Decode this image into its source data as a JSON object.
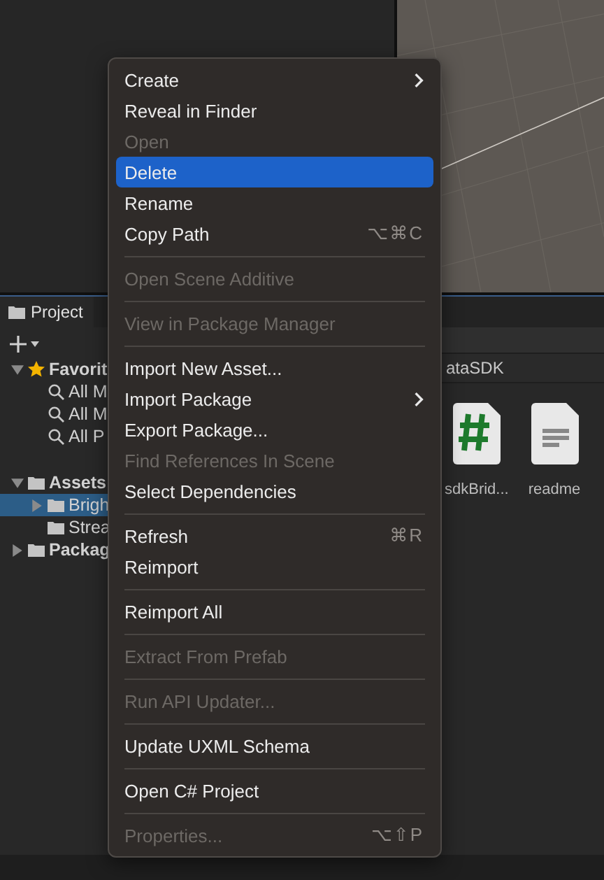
{
  "project_tab": {
    "label": "Project",
    "selected": true
  },
  "tree": [
    {
      "label": "Favorit",
      "kind": "star",
      "expanded": true,
      "selected": false,
      "children": [
        {
          "label": "All M",
          "kind": "search",
          "selected": false
        },
        {
          "label": "All M",
          "kind": "search",
          "selected": false
        },
        {
          "label": "All P",
          "kind": "search",
          "selected": false
        }
      ]
    },
    {
      "label": "Assets",
      "kind": "folder",
      "expanded": true,
      "selected": false,
      "children": [
        {
          "label": "Brigh",
          "kind": "folder",
          "expanded": false,
          "selected": true
        },
        {
          "label": "Strea",
          "kind": "folder",
          "selected": false
        }
      ]
    },
    {
      "label": "Packag",
      "kind": "folder",
      "expanded": false,
      "selected": false
    }
  ],
  "breadcrumb": "ataSDK",
  "files": [
    {
      "label": "sdkBrid...",
      "kind": "script"
    },
    {
      "label": "readme",
      "kind": "text"
    }
  ],
  "menu": [
    {
      "kind": "item",
      "label": "Create",
      "submenu": true,
      "disabled": false,
      "selected": false
    },
    {
      "kind": "item",
      "label": "Reveal in Finder",
      "disabled": false,
      "selected": false
    },
    {
      "kind": "item",
      "label": "Open",
      "disabled": true,
      "selected": false
    },
    {
      "kind": "item",
      "label": "Delete",
      "disabled": false,
      "selected": true
    },
    {
      "kind": "item",
      "label": "Rename",
      "disabled": false,
      "selected": false
    },
    {
      "kind": "item",
      "label": "Copy Path",
      "shortcut": "⌥⌘C",
      "disabled": false,
      "selected": false
    },
    {
      "kind": "separator"
    },
    {
      "kind": "item",
      "label": "Open Scene Additive",
      "disabled": true,
      "selected": false
    },
    {
      "kind": "separator"
    },
    {
      "kind": "item",
      "label": "View in Package Manager",
      "disabled": true,
      "selected": false
    },
    {
      "kind": "separator"
    },
    {
      "kind": "item",
      "label": "Import New Asset...",
      "disabled": false,
      "selected": false
    },
    {
      "kind": "item",
      "label": "Import Package",
      "submenu": true,
      "disabled": false,
      "selected": false
    },
    {
      "kind": "item",
      "label": "Export Package...",
      "disabled": false,
      "selected": false
    },
    {
      "kind": "item",
      "label": "Find References In Scene",
      "disabled": true,
      "selected": false
    },
    {
      "kind": "item",
      "label": "Select Dependencies",
      "disabled": false,
      "selected": false
    },
    {
      "kind": "separator"
    },
    {
      "kind": "item",
      "label": "Refresh",
      "shortcut": "⌘R",
      "disabled": false,
      "selected": false
    },
    {
      "kind": "item",
      "label": "Reimport",
      "disabled": false,
      "selected": false
    },
    {
      "kind": "separator"
    },
    {
      "kind": "item",
      "label": "Reimport All",
      "disabled": false,
      "selected": false
    },
    {
      "kind": "separator"
    },
    {
      "kind": "item",
      "label": "Extract From Prefab",
      "disabled": true,
      "selected": false
    },
    {
      "kind": "separator"
    },
    {
      "kind": "item",
      "label": "Run API Updater...",
      "disabled": true,
      "selected": false
    },
    {
      "kind": "separator"
    },
    {
      "kind": "item",
      "label": "Update UXML Schema",
      "disabled": false,
      "selected": false
    },
    {
      "kind": "separator"
    },
    {
      "kind": "item",
      "label": "Open C# Project",
      "disabled": false,
      "selected": false
    },
    {
      "kind": "separator"
    },
    {
      "kind": "item",
      "label": "Properties...",
      "shortcut": "⌥⇧P",
      "disabled": true,
      "selected": false
    }
  ]
}
